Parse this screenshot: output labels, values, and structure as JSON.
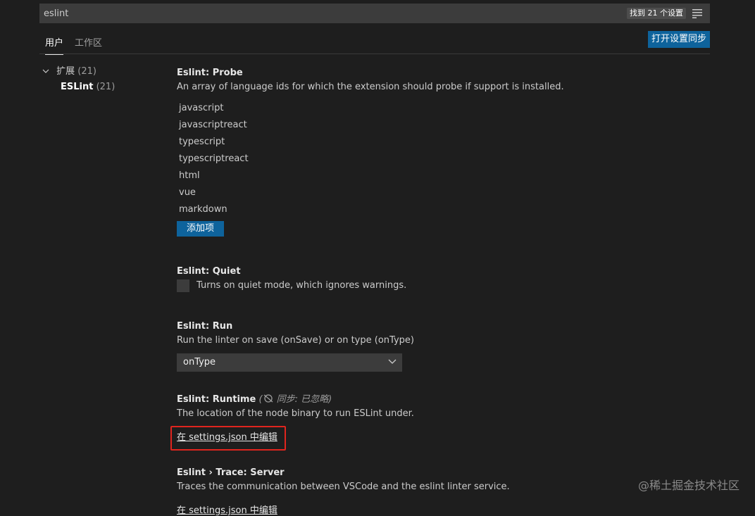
{
  "search": {
    "value": "eslint",
    "result_count": "找到 21 个设置"
  },
  "tabs": {
    "user": "用户",
    "workspace": "工作区",
    "sync_button": "打开设置同步"
  },
  "toc": {
    "group_label": "扩展",
    "group_count": "(21)",
    "child_label": "ESLint",
    "child_count": "(21)"
  },
  "settings": {
    "probe": {
      "prefix": "Eslint: ",
      "name": "Probe",
      "description": "An array of language ids for which the extension should probe if support is installed.",
      "items": [
        "javascript",
        "javascriptreact",
        "typescript",
        "typescriptreact",
        "html",
        "vue",
        "markdown"
      ],
      "add_button": "添加项"
    },
    "quiet": {
      "prefix": "Eslint: ",
      "name": "Quiet",
      "description": "Turns on quiet mode, which ignores warnings."
    },
    "run": {
      "prefix": "Eslint: ",
      "name": "Run",
      "description": "Run the linter on save (onSave) or on type (onType)",
      "selected": "onType"
    },
    "runtime": {
      "prefix": "Eslint: ",
      "name": "Runtime",
      "sync_tag": "同步: 已忽略",
      "description": "The location of the node binary to run ESLint under.",
      "edit_link": "在 settings.json 中编辑"
    },
    "trace": {
      "prefix": "Eslint › Trace: ",
      "name": "Server",
      "description": "Traces the communication between VSCode and the eslint linter service.",
      "edit_link": "在 settings.json 中编辑"
    }
  },
  "watermark": "@稀土掘金技术社区",
  "colors": {
    "accent": "#0e639c",
    "highlight": "#e0251e",
    "background": "#1e1e1e"
  }
}
